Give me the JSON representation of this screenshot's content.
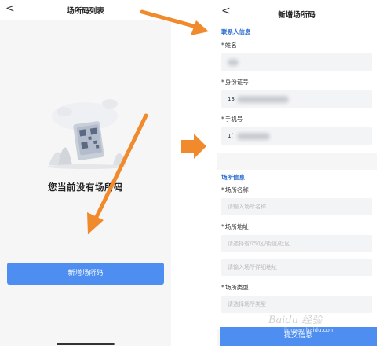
{
  "left": {
    "title": "场所码列表",
    "back": "<",
    "empty_text": "您当前没有场所码",
    "primary_button": "新增场所码"
  },
  "right": {
    "title": "新增场所码",
    "back": "<",
    "contact_section": {
      "title": "联系人信息",
      "fields": [
        {
          "label": "姓名",
          "value": ""
        },
        {
          "label": "身份证号",
          "value": "13"
        },
        {
          "label": "手机号",
          "value": "1("
        }
      ]
    },
    "place_section": {
      "title": "场所信息",
      "name_label": "场所名称",
      "name_placeholder": "请输入场所名称",
      "address_label": "场所地址",
      "address_placeholder_1": "请选择省/市/区/街道/社区",
      "address_placeholder_2": "请输入场所详细地址",
      "type_label": "场所类型",
      "type_placeholder": "请选择场所类型"
    },
    "submit_button": "提交信息"
  },
  "required_mark": "*",
  "watermark": "Baidu 经验",
  "watermark_url": "jingyan.baidu.com",
  "colors": {
    "primary": "#4d8ef0",
    "arrow": "#f08a2c",
    "section_title": "#2f6fd3"
  }
}
